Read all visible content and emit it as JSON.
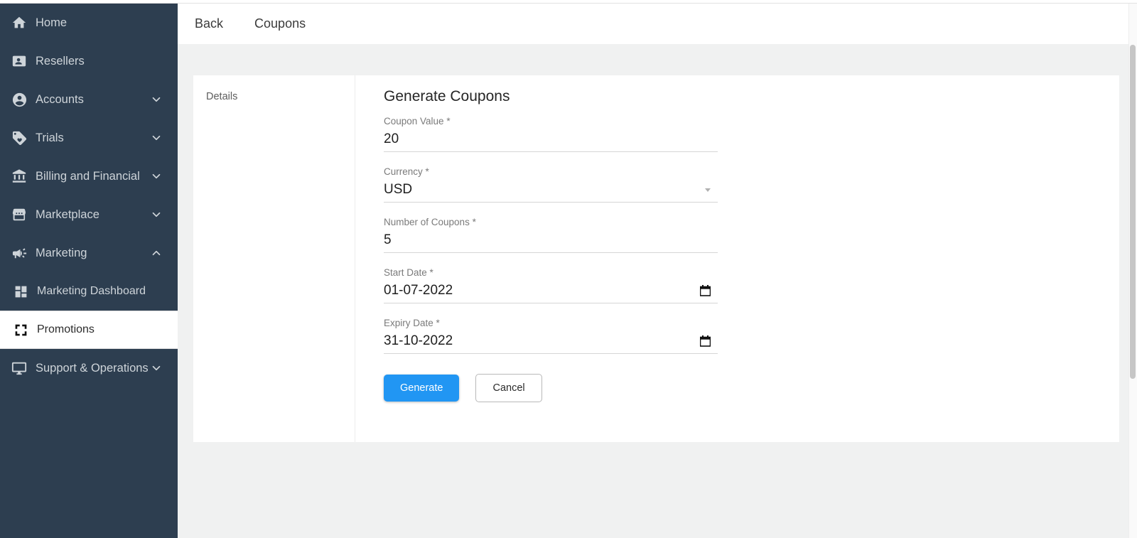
{
  "sidebar": {
    "background_color": "#2d3e50",
    "active_background_color": "#ffffff",
    "items": [
      {
        "label": "Home",
        "icon": "home-icon",
        "expandable": false,
        "expanded": false,
        "active": false,
        "sub": false
      },
      {
        "label": "Resellers",
        "icon": "contact-card-icon",
        "expandable": false,
        "expanded": false,
        "active": false,
        "sub": false
      },
      {
        "label": "Accounts",
        "icon": "account-circle-icon",
        "expandable": true,
        "expanded": false,
        "active": false,
        "sub": false
      },
      {
        "label": "Trials",
        "icon": "loyalty-tag-icon",
        "expandable": true,
        "expanded": false,
        "active": false,
        "sub": false
      },
      {
        "label": "Billing and Financial",
        "icon": "bank-icon",
        "expandable": true,
        "expanded": false,
        "active": false,
        "sub": false
      },
      {
        "label": "Marketplace",
        "icon": "storefront-icon",
        "expandable": true,
        "expanded": false,
        "active": false,
        "sub": false
      },
      {
        "label": "Marketing",
        "icon": "megaphone-icon",
        "expandable": true,
        "expanded": true,
        "active": false,
        "sub": false
      },
      {
        "label": "Marketing Dashboard",
        "icon": "dashboard-grid-icon",
        "expandable": false,
        "expanded": false,
        "active": false,
        "sub": true
      },
      {
        "label": "Promotions",
        "icon": "promotions-icon",
        "expandable": false,
        "expanded": false,
        "active": true,
        "sub": true
      },
      {
        "label": "Support & Operations",
        "icon": "monitor-icon",
        "expandable": true,
        "expanded": false,
        "active": false,
        "sub": false
      }
    ]
  },
  "header": {
    "items": [
      {
        "label": "Back"
      },
      {
        "label": "Coupons"
      }
    ]
  },
  "card": {
    "left_tab": {
      "label": "Details"
    },
    "form": {
      "title": "Generate Coupons",
      "fields": [
        {
          "label": "Coupon Value *",
          "value": "20",
          "type": "text",
          "trailing_icon": "none"
        },
        {
          "label": "Currency *",
          "value": "USD",
          "type": "select",
          "trailing_icon": "chevron-down-icon"
        },
        {
          "label": "Number of Coupons *",
          "value": "5",
          "type": "text",
          "trailing_icon": "none"
        },
        {
          "label": "Start Date *",
          "value": "01-07-2022",
          "type": "date",
          "trailing_icon": "calendar-icon"
        },
        {
          "label": "Expiry Date *",
          "value": "31-10-2022",
          "type": "date",
          "trailing_icon": "calendar-icon"
        }
      ],
      "buttons": {
        "primary_label": "Generate",
        "primary_color": "#2196f3",
        "secondary_label": "Cancel"
      }
    }
  }
}
